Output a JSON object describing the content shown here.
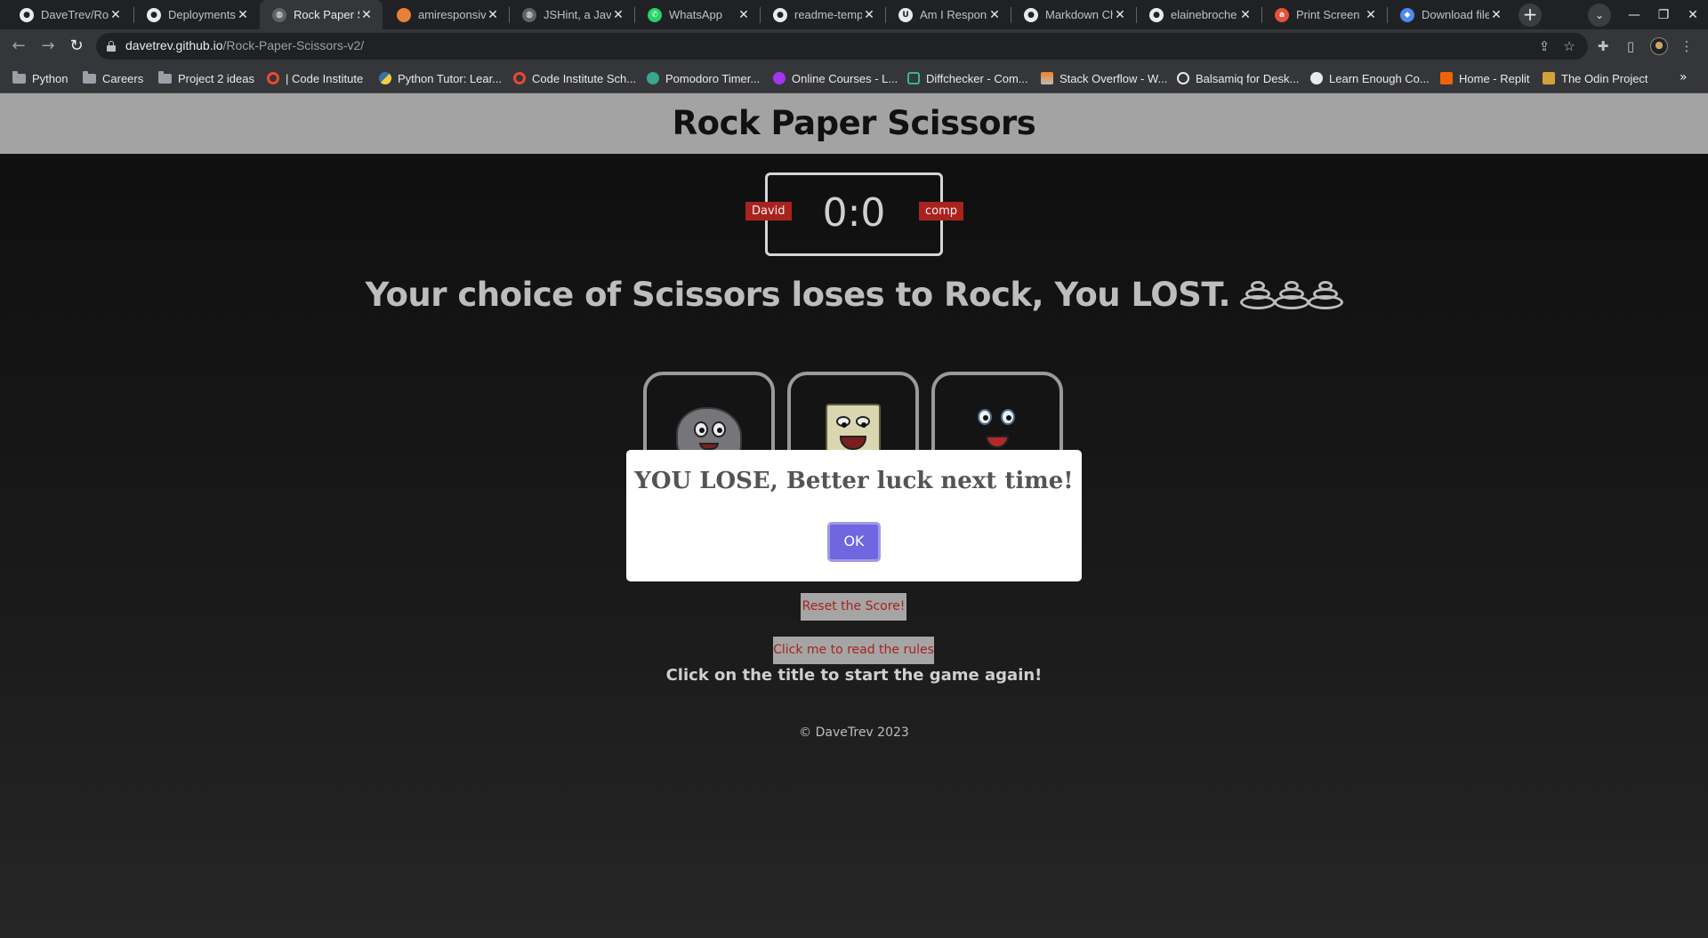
{
  "browser": {
    "tabs": [
      {
        "title": "DaveTrev/Roc",
        "icon": "github-icon",
        "active": false
      },
      {
        "title": "Deployments",
        "icon": "github-icon",
        "active": false
      },
      {
        "title": "Rock Paper Sc",
        "icon": "globe-icon",
        "active": true
      },
      {
        "title": "amiresponsiv",
        "icon": "amiresponsive-icon",
        "active": false
      },
      {
        "title": "JSHint, a Java",
        "icon": "globe-icon",
        "active": false
      },
      {
        "title": "WhatsApp",
        "icon": "whatsapp-icon",
        "active": false
      },
      {
        "title": "readme-temp",
        "icon": "github-icon",
        "active": false
      },
      {
        "title": "Am I Respons",
        "icon": "ui-icon",
        "active": false
      },
      {
        "title": "Markdown Ch",
        "icon": "github-icon",
        "active": false
      },
      {
        "title": "elainebroche",
        "icon": "github-icon",
        "active": false
      },
      {
        "title": "Print Screen",
        "icon": "ask-icon",
        "active": false
      },
      {
        "title": "Download file",
        "icon": "gdrive-icon",
        "active": false
      }
    ],
    "url_host": "davetrev.github.io",
    "url_path": "/Rock-Paper-Scissors-v2/",
    "bookmarks": [
      {
        "label": "Python",
        "icon": "folder-icon"
      },
      {
        "label": "Careers",
        "icon": "folder-icon"
      },
      {
        "label": "Project 2 ideas",
        "icon": "folder-icon"
      },
      {
        "label": "| Code Institute",
        "icon": "code-institute-icon"
      },
      {
        "label": "Python Tutor: Lear...",
        "icon": "python-icon"
      },
      {
        "label": "Code Institute Sch...",
        "icon": "code-institute-icon"
      },
      {
        "label": "Pomodoro Timer...",
        "icon": "check-icon"
      },
      {
        "label": "Online Courses - L...",
        "icon": "udemy-icon"
      },
      {
        "label": "Diffchecker - Com...",
        "icon": "diffchecker-icon"
      },
      {
        "label": "Stack Overflow - W...",
        "icon": "stackoverflow-icon"
      },
      {
        "label": "Balsamiq for Desk...",
        "icon": "balsamiq-icon"
      },
      {
        "label": "Learn Enough Co...",
        "icon": "learnenough-icon"
      },
      {
        "label": "Home - Replit",
        "icon": "replit-icon"
      },
      {
        "label": "The Odin Project",
        "icon": "odin-icon"
      }
    ]
  },
  "game": {
    "title": "Rock Paper Scissors",
    "score": "0:0",
    "player_name": "David",
    "computer_name": "comp",
    "result_message": "Your choice of Scissors loses to Rock, You LOST.",
    "result_emoji": "poop-emoji",
    "choices": [
      {
        "name": "Rock",
        "icon": "rock-character"
      },
      {
        "name": "Paper",
        "icon": "paper-character"
      },
      {
        "name": "Scissors",
        "icon": "scissors-character"
      }
    ],
    "reset_label": "Reset the Score!",
    "rules_label": "Click me to read the rules",
    "restart_note": "Click on the title to start the game again!",
    "footer": "© DaveTrev 2023"
  },
  "modal": {
    "message": "YOU LOSE, Better luck next time!",
    "ok_label": "OK",
    "ok_color": "#7066e0"
  },
  "colors": {
    "accent_red": "#a8231f",
    "header_grey": "#a3a3a3"
  }
}
